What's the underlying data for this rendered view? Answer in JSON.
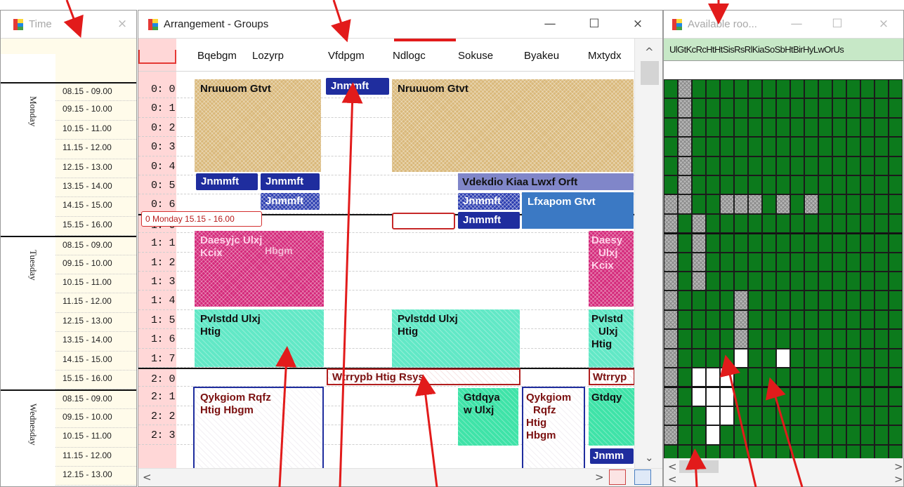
{
  "time_window": {
    "title": "Time",
    "close": "×",
    "days": [
      {
        "label": "Monday",
        "slots": [
          "08.15 - 09.00",
          "09.15 - 10.00",
          "10.15 - 11.00",
          "11.15 - 12.00",
          "12.15 - 13.00",
          "13.15 - 14.00",
          "14.15 - 15.00",
          "15.15 - 16.00"
        ]
      },
      {
        "label": "Tuesday",
        "slots": [
          "08.15 - 09.00",
          "09.15 - 10.00",
          "10.15 - 11.00",
          "11.15 - 12.00",
          "12.15 - 13.00",
          "13.15 - 14.00",
          "14.15 - 15.00",
          "15.15 - 16.00"
        ]
      },
      {
        "label": "Wednesday",
        "slots": [
          "08.15 - 09.00",
          "09.15 - 10.00",
          "10.15 - 11.00",
          "11.15 - 12.00",
          "12.15 - 13.00"
        ]
      }
    ]
  },
  "arrangement_window": {
    "title": "Arrangement - Groups",
    "buttons": {
      "minimize": "—",
      "maximize": "☐",
      "close": "×"
    },
    "columns": [
      "Bqebgm",
      "Lozyrp",
      "Vfdpgm",
      "Ndlogc",
      "Sokuse",
      "Byakeu",
      "Mxtydx"
    ],
    "periods": [
      "0: 0",
      "0: 1",
      "0: 2",
      "0: 3",
      "0: 4",
      "0: 5",
      "0: 6",
      "1: 0",
      "1: 1",
      "1: 2",
      "1: 3",
      "1: 4",
      "1: 5",
      "1: 6",
      "1: 7",
      "2: 0",
      "2: 1",
      "2: 2",
      "2: 3"
    ],
    "selection_label": "0 Monday 15.15 - 16.00",
    "blocks": {
      "nruuuom_a": "Nruuuom Gtvt",
      "nruuuom_b": "Nruuuom Gtvt",
      "jnmmft_top": "Jnmmft",
      "jnmmft_1": "Jnmmft",
      "jnmmft_2": "Jnmmft",
      "jnmmft_3": "Jnmmft",
      "jnmmft_4": "Jnmmft",
      "jnmmft_5": "Jnmmft",
      "jnmmft_6": "Jnmm",
      "vdekdio": "Vdekdio Kiaa Lwxf Orft",
      "lfxapom": "Lfxapom Gtvt",
      "daesyjc_a1": "Daesyjc Ulxj",
      "daesyjc_a2": "Kcix",
      "hbgm": "Hbgm",
      "daesyjc_b1": "Daesy",
      "daesyjc_b2": "Ulxj",
      "daesyjc_b3": "Kcix",
      "pvlstdd_a1": "Pvlstdd Ulxj",
      "pvlstdd_a2": "Htig",
      "pvlstdd_b1": "Pvlstdd Ulxj",
      "pvlstdd_b2": "Htig",
      "pvlstdd_c1": "Pvlstd",
      "pvlstdd_c2": "Ulxj",
      "pvlstdd_c3": "Htig",
      "wtrrypb": "Wtrrypb Htig Rsys",
      "wtrryp": "Wtrryp",
      "qykgiom_a1": "Qykgiom Rqfz",
      "qykgiom_a2": "Htig Hbgm",
      "gtdqya_a1": "Gtdqya",
      "gtdqya_a2": "w Ulxj",
      "qykgiom_b1": "Qykgiom",
      "qykgiom_b2": "Rqfz",
      "qykgiom_b3": "Htig",
      "qykgiom_b4": "Hbgm",
      "gtdqya_b": "Gtdqy"
    },
    "scroll_glyphs": {
      "up": "^",
      "down": "⌄",
      "left": "<",
      "right": ">"
    }
  },
  "rooms_window": {
    "title": "Available roo...",
    "buttons": {
      "minimize": "—",
      "maximize": "☐",
      "close": "×"
    },
    "header": "UlGtKcRcHtHtSisRsRlKiaSoSbHtBirHyLwOrUs",
    "grid_rows": 20,
    "grid_cols": 17,
    "occupied_cells": [
      [
        0,
        1
      ],
      [
        1,
        1
      ],
      [
        2,
        1
      ],
      [
        3,
        1
      ],
      [
        4,
        1
      ],
      [
        5,
        1
      ],
      [
        6,
        1
      ],
      [
        6,
        0
      ],
      [
        6,
        4
      ],
      [
        6,
        5
      ],
      [
        6,
        6
      ],
      [
        6,
        8
      ],
      [
        6,
        10
      ],
      [
        7,
        0
      ],
      [
        7,
        2
      ],
      [
        8,
        0
      ],
      [
        8,
        2
      ],
      [
        9,
        0
      ],
      [
        9,
        2
      ],
      [
        10,
        0
      ],
      [
        10,
        2
      ],
      [
        11,
        0
      ],
      [
        11,
        5
      ],
      [
        12,
        0
      ],
      [
        12,
        5
      ],
      [
        13,
        0
      ],
      [
        13,
        5
      ],
      [
        14,
        0
      ],
      [
        15,
        0
      ],
      [
        16,
        0
      ],
      [
        17,
        0
      ],
      [
        18,
        0
      ]
    ],
    "free_cells": [
      [
        14,
        5
      ],
      [
        14,
        8
      ],
      [
        15,
        3
      ],
      [
        15,
        4
      ],
      [
        16,
        3
      ],
      [
        16,
        4
      ],
      [
        17,
        3
      ],
      [
        17,
        4
      ],
      [
        15,
        2
      ],
      [
        16,
        2
      ],
      [
        18,
        3
      ]
    ],
    "scroll_glyphs": {
      "left": "<",
      "right": ">"
    },
    "colors": {
      "available": "#0c7a1c",
      "occupied": "#b5b5b5",
      "free": "#ffffff"
    }
  }
}
